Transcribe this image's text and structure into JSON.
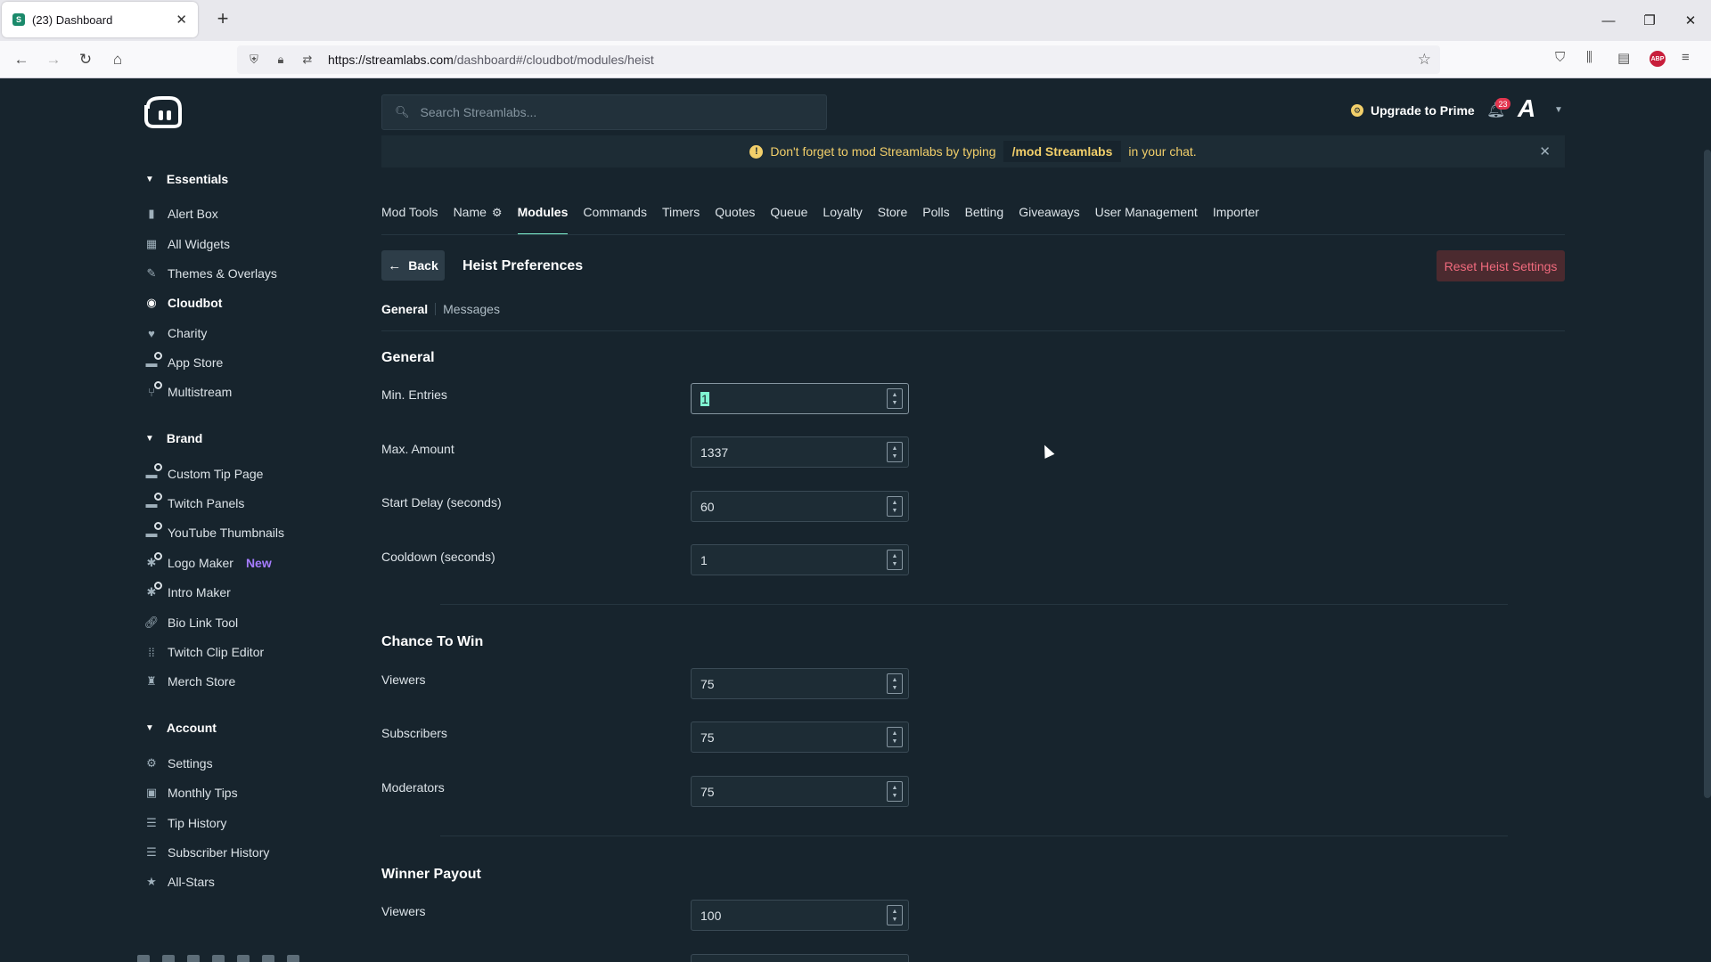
{
  "browser": {
    "tab_title": "(23) Dashboard",
    "url_host": "https://streamlabs.com",
    "url_path": "/dashboard#/cloudbot/modules/heist"
  },
  "sidebar": {
    "sections": [
      {
        "label": "Essentials",
        "items": [
          {
            "label": "Alert Box",
            "icon": "bell-icon"
          },
          {
            "label": "All Widgets",
            "icon": "grid-icon"
          },
          {
            "label": "Themes & Overlays",
            "icon": "brush-icon"
          },
          {
            "label": "Cloudbot",
            "icon": "bot-icon",
            "active": true
          },
          {
            "label": "Charity",
            "icon": "heart-icon"
          },
          {
            "label": "App Store",
            "icon": "store-icon"
          },
          {
            "label": "Multistream",
            "icon": "multistream-icon"
          }
        ]
      },
      {
        "label": "Brand",
        "items": [
          {
            "label": "Custom Tip Page",
            "icon": "tip-page-icon"
          },
          {
            "label": "Twitch Panels",
            "icon": "panels-icon"
          },
          {
            "label": "YouTube Thumbnails",
            "icon": "thumbnail-icon"
          },
          {
            "label": "Logo Maker",
            "icon": "logo-maker-icon",
            "badge": "New"
          },
          {
            "label": "Intro Maker",
            "icon": "intro-icon"
          },
          {
            "label": "Bio Link Tool",
            "icon": "link-icon"
          },
          {
            "label": "Twitch Clip Editor",
            "icon": "clip-icon"
          },
          {
            "label": "Merch Store",
            "icon": "shirt-icon"
          }
        ]
      },
      {
        "label": "Account",
        "items": [
          {
            "label": "Settings",
            "icon": "gear-icon"
          },
          {
            "label": "Monthly Tips",
            "icon": "calendar-icon"
          },
          {
            "label": "Tip History",
            "icon": "list-icon"
          },
          {
            "label": "Subscriber History",
            "icon": "list-icon"
          },
          {
            "label": "All-Stars",
            "icon": "star-icon"
          }
        ]
      }
    ]
  },
  "header": {
    "search_placeholder": "Search Streamlabs...",
    "upgrade_label": "Upgrade to Prime",
    "notification_count": "23"
  },
  "notice": {
    "text_before": "Don't forget to mod Streamlabs by typing",
    "command": "/mod Streamlabs",
    "text_after": "in your chat."
  },
  "tabs": [
    {
      "label": "Mod Tools"
    },
    {
      "label": "Name",
      "gear": true
    },
    {
      "label": "Modules",
      "active": true
    },
    {
      "label": "Commands"
    },
    {
      "label": "Timers"
    },
    {
      "label": "Quotes"
    },
    {
      "label": "Queue"
    },
    {
      "label": "Loyalty"
    },
    {
      "label": "Store"
    },
    {
      "label": "Polls"
    },
    {
      "label": "Betting"
    },
    {
      "label": "Giveaways"
    },
    {
      "label": "User Management"
    },
    {
      "label": "Importer"
    }
  ],
  "page": {
    "back_label": "Back",
    "title": "Heist Preferences",
    "reset_label": "Reset Heist Settings",
    "subtabs": [
      "General",
      "Messages"
    ]
  },
  "groups": {
    "general": {
      "title": "General",
      "fields": [
        {
          "label": "Min. Entries",
          "value": "1"
        },
        {
          "label": "Max. Amount",
          "value": "1337"
        },
        {
          "label": "Start Delay (seconds)",
          "value": "60"
        },
        {
          "label": "Cooldown (seconds)",
          "value": "1"
        }
      ]
    },
    "chance": {
      "title": "Chance To Win",
      "fields": [
        {
          "label": "Viewers",
          "value": "75"
        },
        {
          "label": "Subscribers",
          "value": "75"
        },
        {
          "label": "Moderators",
          "value": "75"
        }
      ]
    },
    "payout": {
      "title": "Winner Payout",
      "fields": [
        {
          "label": "Viewers",
          "value": "100"
        }
      ]
    }
  }
}
